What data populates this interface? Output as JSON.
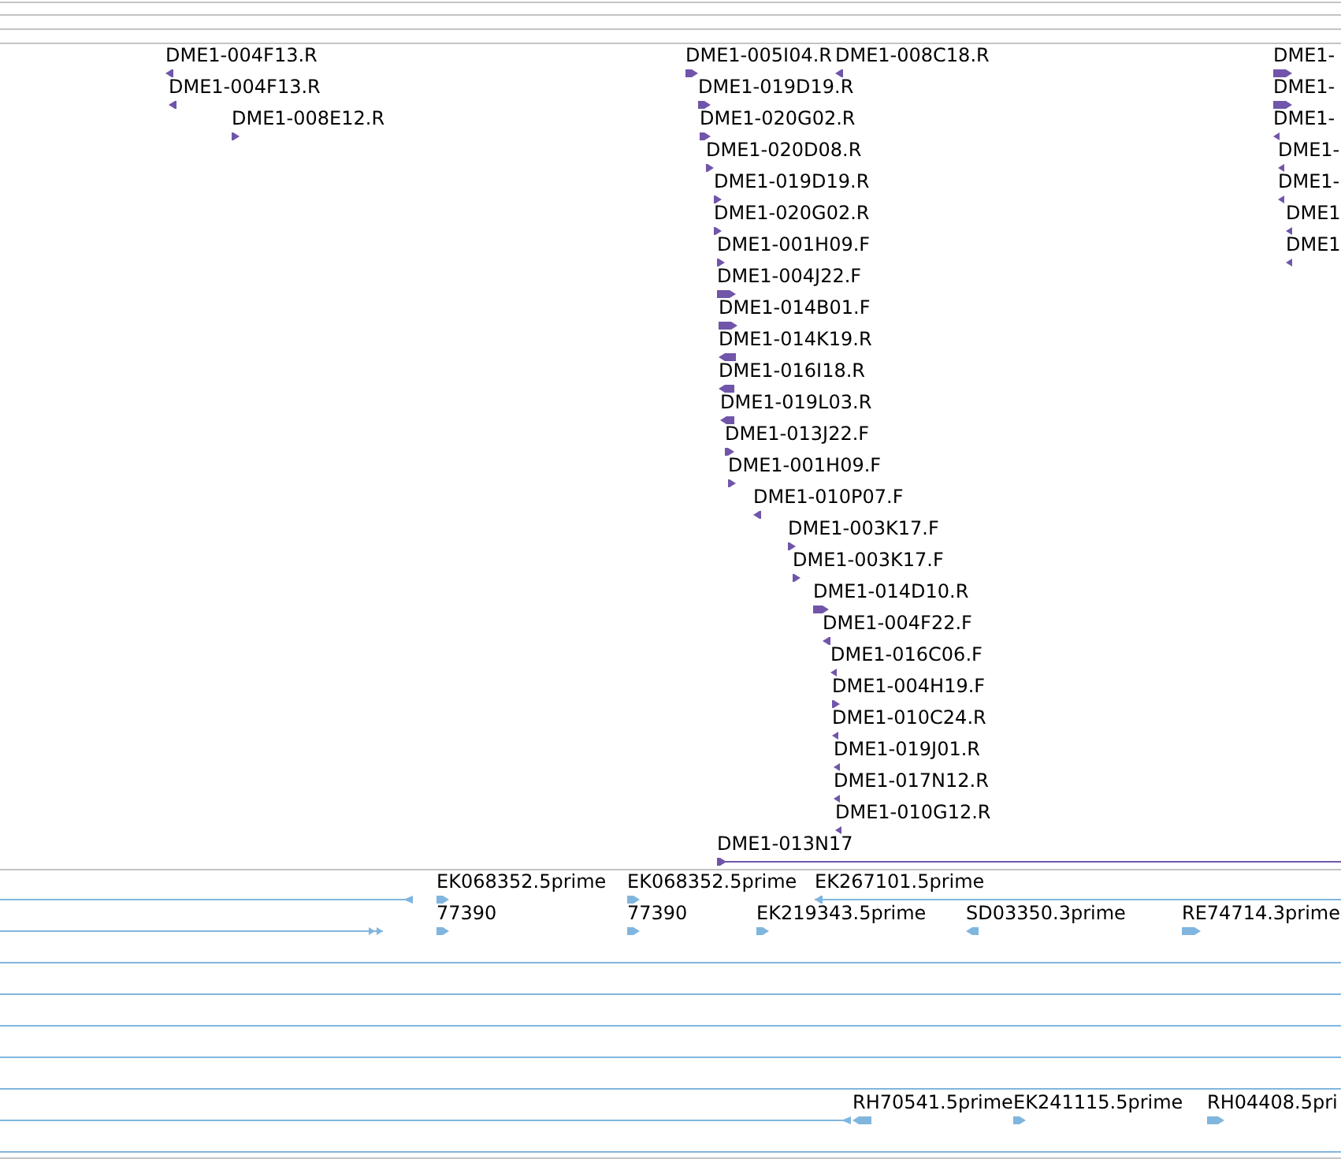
{
  "tracks": [
    {
      "color": "#7055aa",
      "features": [
        {
          "kind": "read",
          "label": "DME1-004F13.R",
          "reverse": true
        },
        {
          "kind": "read",
          "label": "DME1-005I04.R",
          "reverse": false
        },
        {
          "kind": "read",
          "label": "DME1-008C18.R",
          "reverse": true
        },
        {
          "kind": "read",
          "label": "DME1-",
          "reverse": false
        },
        {
          "kind": "read",
          "label": "DME1-004F13.R",
          "reverse": true
        },
        {
          "kind": "read",
          "label": "DME1-019D19.R",
          "reverse": false
        },
        {
          "kind": "read",
          "label": "DME1-",
          "reverse": false
        },
        {
          "kind": "read",
          "label": "DME1-008E12.R",
          "reverse": false
        },
        {
          "kind": "read",
          "label": "DME1-020G02.R",
          "reverse": false
        },
        {
          "kind": "read",
          "label": "DME1-",
          "reverse": true
        },
        {
          "kind": "read",
          "label": "DME1-020D08.R",
          "reverse": false
        },
        {
          "kind": "read",
          "label": "DME1-",
          "reverse": true
        },
        {
          "kind": "read",
          "label": "DME1-019D19.R",
          "reverse": false
        },
        {
          "kind": "read",
          "label": "DME1-",
          "reverse": true
        },
        {
          "kind": "read",
          "label": "DME1-020G02.R",
          "reverse": false
        },
        {
          "kind": "read",
          "label": "DME1",
          "reverse": true
        },
        {
          "kind": "read",
          "label": "DME1-001H09.F",
          "reverse": false
        },
        {
          "kind": "read",
          "label": "DME1",
          "reverse": true
        },
        {
          "kind": "read",
          "label": "DME1-004J22.F",
          "reverse": false
        },
        {
          "kind": "read",
          "label": "DME1-014B01.F",
          "reverse": false
        },
        {
          "kind": "read",
          "label": "DME1-014K19.R",
          "reverse": true
        },
        {
          "kind": "read",
          "label": "DME1-016I18.R",
          "reverse": true
        },
        {
          "kind": "read",
          "label": "DME1-019L03.R",
          "reverse": true
        },
        {
          "kind": "read",
          "label": "DME1-013J22.F",
          "reverse": false
        },
        {
          "kind": "read",
          "label": "DME1-001H09.F",
          "reverse": false
        },
        {
          "kind": "read",
          "label": "DME1-010P07.F",
          "reverse": true
        },
        {
          "kind": "read",
          "label": "DME1-003K17.F",
          "reverse": false
        },
        {
          "kind": "read",
          "label": "DME1-003K17.F",
          "reverse": false
        },
        {
          "kind": "read",
          "label": "DME1-014D10.R",
          "reverse": false
        },
        {
          "kind": "read",
          "label": "DME1-004F22.F",
          "reverse": true
        },
        {
          "kind": "read",
          "label": "DME1-016C06.F",
          "reverse": true
        },
        {
          "kind": "read",
          "label": "DME1-004H19.F",
          "reverse": false
        },
        {
          "kind": "read",
          "label": "DME1-010C24.R",
          "reverse": true
        },
        {
          "kind": "read",
          "label": "DME1-019J01.R",
          "reverse": true
        },
        {
          "kind": "read",
          "label": "DME1-017N12.R",
          "reverse": true
        },
        {
          "kind": "read",
          "label": "DME1-010G12.R",
          "reverse": true
        },
        {
          "kind": "read",
          "label": "DME1-013N17",
          "reverse": false
        }
      ]
    },
    {
      "color": "#80b6de",
      "features": [
        {
          "kind": "span",
          "reverse": true
        },
        {
          "kind": "read",
          "label": "EK068352.5prime",
          "reverse": false
        },
        {
          "kind": "read",
          "label": "EK068352.5prime",
          "reverse": false
        },
        {
          "kind": "read",
          "label": "EK267101.5prime",
          "reverse": true
        },
        {
          "kind": "span",
          "reverse": false
        },
        {
          "kind": "read",
          "label": "77390",
          "reverse": false
        },
        {
          "kind": "read",
          "label": "77390",
          "reverse": false
        },
        {
          "kind": "read",
          "label": "EK219343.5prime",
          "reverse": false
        },
        {
          "kind": "read",
          "label": "SD03350.3prime",
          "reverse": true
        },
        {
          "kind": "read",
          "label": "RE74714.3prime",
          "reverse": false
        },
        {
          "kind": "through"
        },
        {
          "kind": "through"
        },
        {
          "kind": "through"
        },
        {
          "kind": "through"
        },
        {
          "kind": "through"
        },
        {
          "kind": "span",
          "reverse": true
        },
        {
          "kind": "read",
          "label": "RH70541.5prime",
          "reverse": true
        },
        {
          "kind": "read",
          "label": "EK241115.5prime",
          "reverse": false
        },
        {
          "kind": "read",
          "label": "RH04408.5pri",
          "reverse": false
        },
        {
          "kind": "through"
        }
      ]
    }
  ]
}
